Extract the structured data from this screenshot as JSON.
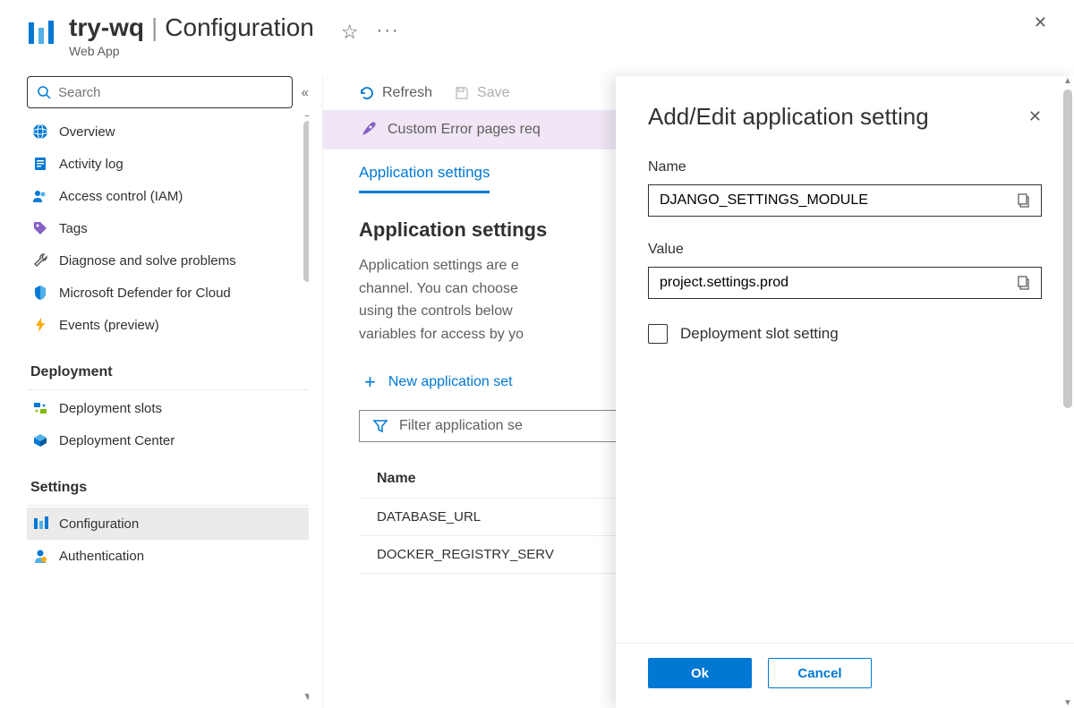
{
  "header": {
    "app_name": "try-wq",
    "section": "Configuration",
    "subtitle": "Web App",
    "star_icon": "star-icon",
    "more_icon": "more-icon"
  },
  "search": {
    "placeholder": "Search"
  },
  "sidebar": {
    "items": [
      {
        "label": "Overview",
        "icon": "globe-icon"
      },
      {
        "label": "Activity log",
        "icon": "log-icon"
      },
      {
        "label": "Access control (IAM)",
        "icon": "people-icon"
      },
      {
        "label": "Tags",
        "icon": "tag-icon"
      },
      {
        "label": "Diagnose and solve problems",
        "icon": "wrench-icon"
      },
      {
        "label": "Microsoft Defender for Cloud",
        "icon": "shield-icon"
      },
      {
        "label": "Events (preview)",
        "icon": "bolt-icon"
      }
    ],
    "group_deployment": "Deployment",
    "deployment_items": [
      {
        "label": "Deployment slots",
        "icon": "slots-icon"
      },
      {
        "label": "Deployment Center",
        "icon": "box-icon"
      }
    ],
    "group_settings": "Settings",
    "settings_items": [
      {
        "label": "Configuration",
        "icon": "bars-icon",
        "active": true
      },
      {
        "label": "Authentication",
        "icon": "person-icon"
      }
    ]
  },
  "toolbar": {
    "refresh": "Refresh",
    "save": "Save"
  },
  "banner": {
    "text": "Custom Error pages req"
  },
  "tabs": {
    "app_settings": "Application settings"
  },
  "section": {
    "title": "Application settings",
    "desc_line1": "Application settings are e",
    "desc_line2": "channel. You can choose",
    "desc_line3": "using the controls below",
    "desc_line4": "variables for access by yo"
  },
  "new_setting_label": "New application set",
  "filter_placeholder": "Filter application se",
  "table": {
    "header_name": "Name",
    "rows": [
      "DATABASE_URL",
      "DOCKER_REGISTRY_SERV"
    ]
  },
  "panel": {
    "title": "Add/Edit application setting",
    "name_label": "Name",
    "name_value": "DJANGO_SETTINGS_MODULE",
    "value_label": "Value",
    "value_value": "project.settings.prod",
    "checkbox_label": "Deployment slot setting",
    "ok": "Ok",
    "cancel": "Cancel"
  }
}
